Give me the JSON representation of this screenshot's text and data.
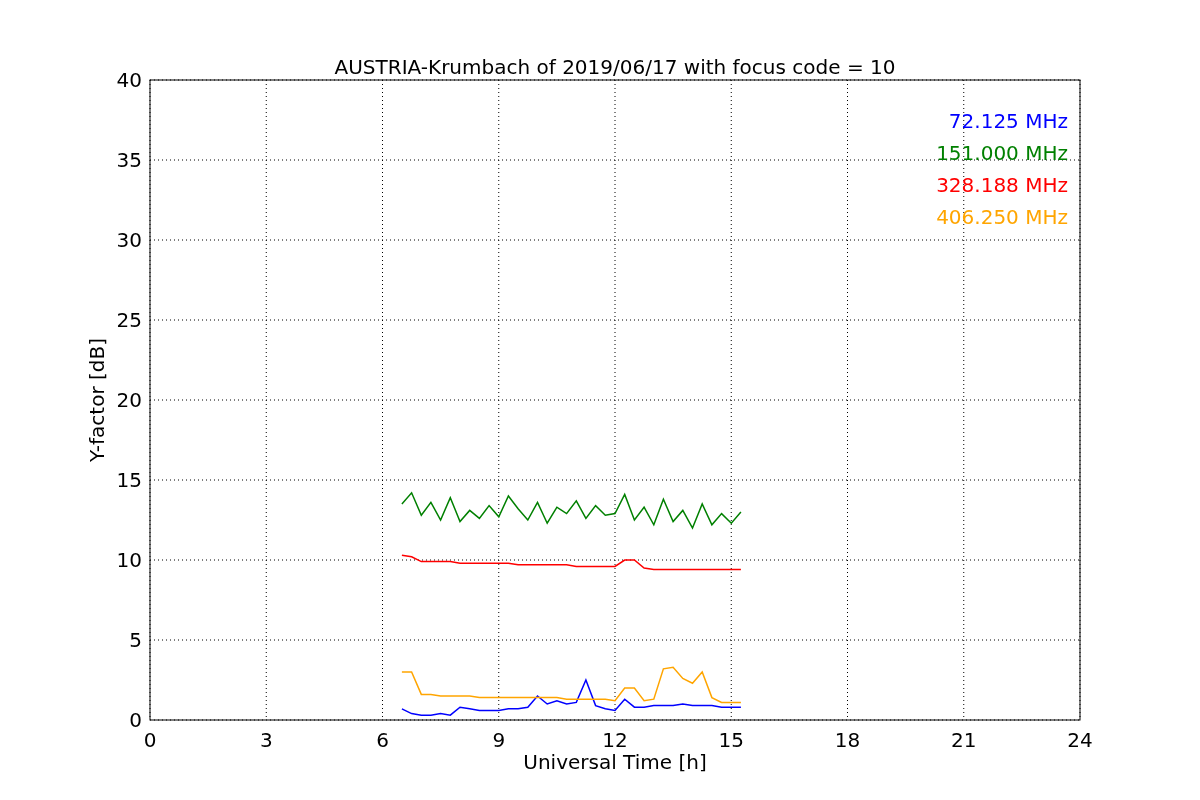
{
  "chart_data": {
    "type": "line",
    "grid": true,
    "title": "AUSTRIA-Krumbach of 2019/06/17 with focus code = 10",
    "xlabel": "Universal Time [h]",
    "ylabel": "Y-factor [dB]",
    "xlim": [
      0,
      24
    ],
    "ylim": [
      0,
      40
    ],
    "xticks": [
      0,
      3,
      6,
      9,
      12,
      15,
      18,
      21,
      24
    ],
    "yticks": [
      0,
      5,
      10,
      15,
      20,
      25,
      30,
      35,
      40
    ],
    "x": [
      6.5,
      6.75,
      7,
      7.25,
      7.5,
      7.75,
      8,
      8.25,
      8.5,
      8.75,
      9,
      9.25,
      9.5,
      9.75,
      10,
      10.25,
      10.5,
      10.75,
      11,
      11.25,
      11.5,
      11.75,
      12,
      12.25,
      12.5,
      12.75,
      13,
      13.25,
      13.5,
      13.75,
      14,
      14.25,
      14.5,
      14.75,
      15,
      15.25
    ],
    "series": [
      {
        "name": "72.125 MHz",
        "color": "#0000ff",
        "values": [
          0.7,
          0.4,
          0.3,
          0.3,
          0.4,
          0.3,
          0.8,
          0.7,
          0.6,
          0.6,
          0.6,
          0.7,
          0.7,
          0.8,
          1.5,
          1.0,
          1.2,
          1.0,
          1.1,
          2.5,
          0.9,
          0.7,
          0.6,
          1.3,
          0.8,
          0.8,
          0.9,
          0.9,
          0.9,
          1.0,
          0.9,
          0.9,
          0.9,
          0.8,
          0.8,
          0.8
        ]
      },
      {
        "name": "151.000 MHz",
        "color": "#008000",
        "values": [
          13.5,
          14.2,
          12.8,
          13.6,
          12.5,
          13.9,
          12.4,
          13.1,
          12.6,
          13.4,
          12.7,
          14.0,
          13.2,
          12.5,
          13.6,
          12.3,
          13.3,
          12.9,
          13.7,
          12.6,
          13.4,
          12.8,
          12.9,
          14.1,
          12.5,
          13.3,
          12.2,
          13.8,
          12.4,
          13.1,
          12.0,
          13.5,
          12.2,
          12.9,
          12.3,
          13.0
        ]
      },
      {
        "name": "328.188 MHz",
        "color": "#ff0000",
        "values": [
          10.3,
          10.2,
          9.9,
          9.9,
          9.9,
          9.9,
          9.8,
          9.8,
          9.8,
          9.8,
          9.8,
          9.8,
          9.7,
          9.7,
          9.7,
          9.7,
          9.7,
          9.7,
          9.6,
          9.6,
          9.6,
          9.6,
          9.6,
          10.0,
          10.0,
          9.5,
          9.4,
          9.4,
          9.4,
          9.4,
          9.4,
          9.4,
          9.4,
          9.4,
          9.4,
          9.4
        ]
      },
      {
        "name": "406.250 MHz",
        "color": "#ffa500",
        "values": [
          3.0,
          3.0,
          1.6,
          1.6,
          1.5,
          1.5,
          1.5,
          1.5,
          1.4,
          1.4,
          1.4,
          1.4,
          1.4,
          1.4,
          1.4,
          1.4,
          1.4,
          1.3,
          1.3,
          1.3,
          1.3,
          1.3,
          1.2,
          2.0,
          2.0,
          1.2,
          1.3,
          3.2,
          3.3,
          2.6,
          2.3,
          3.0,
          1.4,
          1.1,
          1.1,
          1.1
        ]
      }
    ]
  }
}
